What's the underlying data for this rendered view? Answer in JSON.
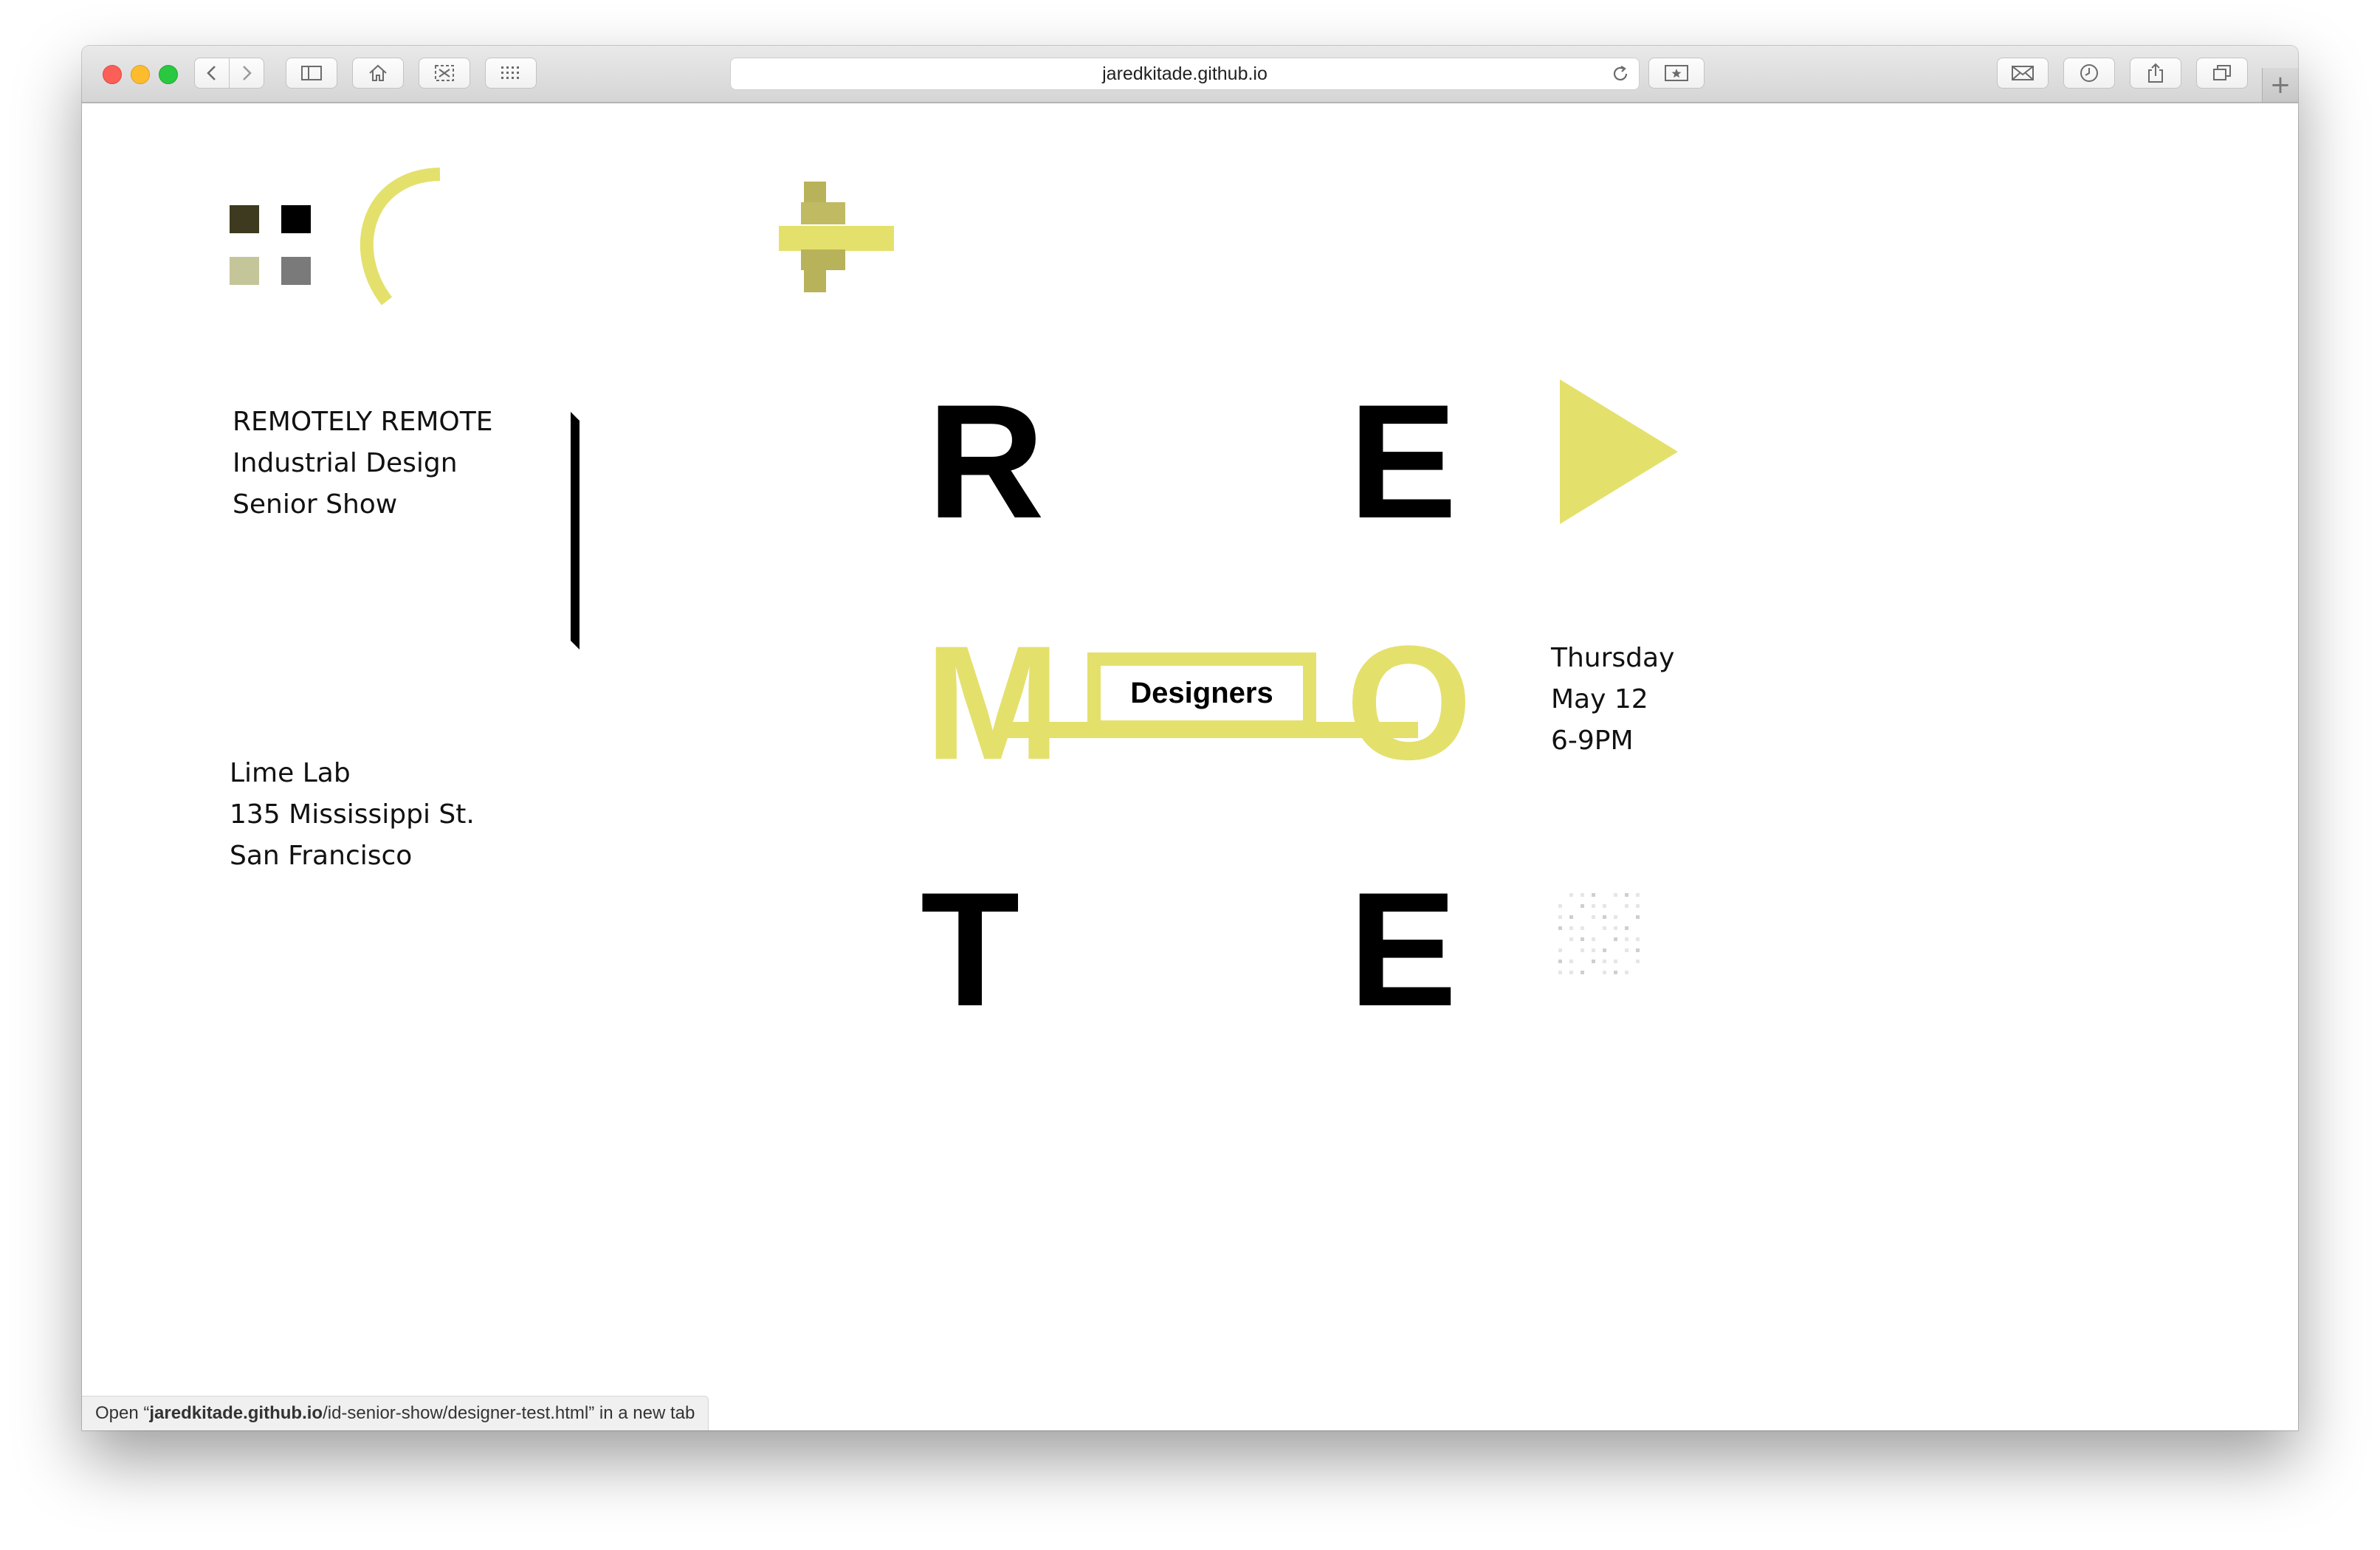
{
  "browser": {
    "url": "jaredkitade.github.io",
    "status_prefix": "Open “",
    "status_url_host": "jaredkitade.github.io",
    "status_url_path": "/id-senior-show/designer-test.html",
    "status_suffix": "” in a new tab",
    "new_tab_symbol": "+",
    "toolbar_icons": [
      "back-icon",
      "forward-icon",
      "sidebar-icon",
      "home-icon",
      "clip-icon",
      "grid-icon",
      "reload-icon",
      "bookmark-star-icon",
      "mail-icon",
      "history-clock-icon",
      "share-icon",
      "tabs-icon"
    ]
  },
  "colors": {
    "accent_yellow": "#e4e06c",
    "accent_olive": "#b8b25a",
    "dark_olive": "#3d3a1f",
    "light_olive": "#c5c59a",
    "gray": "#7a7a7a",
    "black": "#000000"
  },
  "event": {
    "title_line1": "REMOTELY REMOTE",
    "title_line2": "Industrial Design",
    "title_line3": "Senior Show",
    "venue_line1": "Lime Lab",
    "venue_line2": "135 Mississippi St.",
    "venue_line3": "San Francisco",
    "day": "Thursday",
    "date": "May 12",
    "time": "6-9PM"
  },
  "grid": {
    "letter_r": "R",
    "letter_e_top": "E",
    "letter_m": "M",
    "letter_o": "O",
    "letter_t": "T",
    "letter_e_bottom": "E",
    "designers_link": "Designers"
  }
}
